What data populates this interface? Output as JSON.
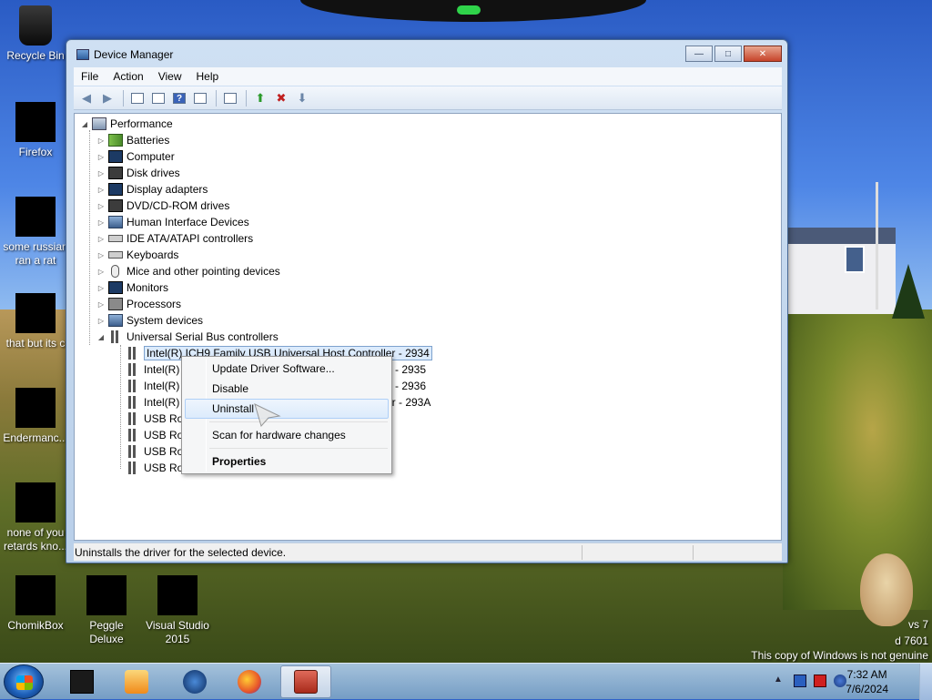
{
  "desktop": {
    "icons": [
      {
        "label": "Recycle Bin",
        "icon": "recycle-bin-icon"
      },
      {
        "label": "Firefox",
        "icon": "firefox-icon"
      },
      {
        "label": "some russian ran a rat",
        "icon": "file-icon"
      },
      {
        "label": "that but its c",
        "icon": "file-icon"
      },
      {
        "label": "Endermanc...",
        "icon": "file-icon"
      },
      {
        "label": "none of you retards kno...",
        "icon": "file-icon"
      },
      {
        "label": "ChomikBox",
        "icon": "chomikbox-icon"
      },
      {
        "label": "Peggle Deluxe",
        "icon": "peggle-icon"
      },
      {
        "label": "Visual Studio 2015",
        "icon": "visual-studio-icon"
      }
    ],
    "notice": {
      "line1": "vs 7",
      "line2": "d 7601",
      "line3": "This copy of Windows is not genuine"
    }
  },
  "window": {
    "title": "Device Manager",
    "buttons": {
      "minimize": "—",
      "maximize": "□",
      "close": "✕"
    },
    "menu": [
      "File",
      "Action",
      "View",
      "Help"
    ],
    "tree": {
      "root": "Performance",
      "categories": [
        "Batteries",
        "Computer",
        "Disk drives",
        "Display adapters",
        "DVD/CD-ROM drives",
        "Human Interface Devices",
        "IDE ATA/ATAPI controllers",
        "Keyboards",
        "Mice and other pointing devices",
        "Monitors",
        "Processors",
        "System devices",
        "Universal Serial Bus controllers"
      ],
      "usb_children": [
        "Intel(R) ICH9 Family USB Universal Host Controller - 2934",
        "Intel(R)",
        "Intel(R)",
        "Intel(R)",
        "USB Ro",
        "USB Ro",
        "USB Ro",
        "USB Ro"
      ],
      "partial_suffixes": [
        "- 2935",
        "- 2936",
        "er - 293A"
      ]
    },
    "status_text": "Uninstalls the driver for the selected device."
  },
  "context_menu": {
    "items": [
      {
        "label": "Update Driver Software...",
        "bold": false
      },
      {
        "label": "Disable",
        "bold": false
      },
      {
        "label": "Uninstall",
        "bold": false,
        "hovered": true
      },
      {
        "label": "Scan for hardware changes",
        "bold": false
      },
      {
        "label": "Properties",
        "bold": true
      }
    ]
  },
  "taskbar": {
    "clock_time": "7:32 AM",
    "clock_date": "7/6/2024"
  }
}
